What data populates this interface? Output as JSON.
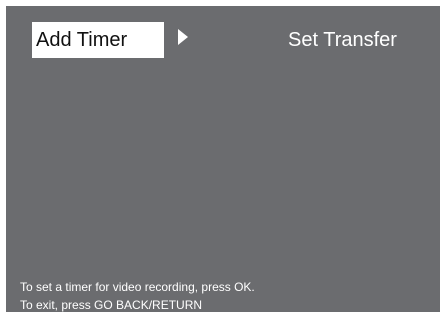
{
  "menu": {
    "selected_label": "Add Timer",
    "next_label": "Set Transfer",
    "arrow_icon": "triangle-right-icon"
  },
  "help": {
    "line1": "To set a timer for video recording, press OK.",
    "line2": "To exit, press GO BACK/RETURN"
  },
  "colors": {
    "screen_background": "#6b6c6f",
    "selected_background": "#ffffff",
    "text": "#ffffff"
  }
}
